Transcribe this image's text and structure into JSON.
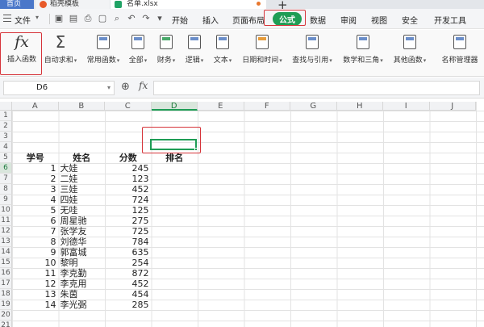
{
  "title_bar": {
    "tabs": [
      {
        "label": "首页",
        "active": false
      },
      {
        "label": "稻壳模板",
        "active": false
      },
      {
        "label": "名单.xlsx",
        "active": true
      }
    ],
    "new_tab_label": "+"
  },
  "menu_bar": {
    "file_label": "文件",
    "quick_access_icons": [
      "save-icon",
      "export-pdf-icon",
      "print-icon",
      "print-preview-icon",
      "search-doc-icon",
      "undo-icon",
      "redo-icon",
      "more-icon"
    ],
    "tabs": [
      {
        "label": "开始",
        "active": false
      },
      {
        "label": "插入",
        "active": false
      },
      {
        "label": "页面布局",
        "active": false
      },
      {
        "label": "公式",
        "active": true
      },
      {
        "label": "数据",
        "active": false
      },
      {
        "label": "审阅",
        "active": false
      },
      {
        "label": "视图",
        "active": false
      },
      {
        "label": "安全",
        "active": false
      },
      {
        "label": "开发工具",
        "active": false
      }
    ]
  },
  "ribbon": {
    "insert_function": {
      "icon": "fx",
      "label": "插入函数"
    },
    "buttons": [
      {
        "label": "自动求和",
        "icon": "sigma-icon",
        "dropdown": true
      },
      {
        "label": "常用函数",
        "icon": "star-function-icon",
        "dropdown": true
      },
      {
        "label": "全部",
        "icon": "all-functions-icon",
        "dropdown": true
      },
      {
        "label": "财务",
        "icon": "finance-icon",
        "dropdown": true
      },
      {
        "label": "逻辑",
        "icon": "logic-icon",
        "dropdown": true
      },
      {
        "label": "文本",
        "icon": "text-function-icon",
        "dropdown": true
      },
      {
        "label": "日期和时间",
        "icon": "clock-icon",
        "dropdown": true
      },
      {
        "label": "查找与引用",
        "icon": "lookup-icon",
        "dropdown": true
      },
      {
        "label": "数学和三角",
        "icon": "math-icon",
        "dropdown": true
      },
      {
        "label": "其他函数",
        "icon": "other-functions-icon",
        "dropdown": true
      },
      {
        "label": "名称管理器",
        "icon": "name-manager-icon",
        "dropdown": false
      }
    ]
  },
  "formula_bar": {
    "name_box": "D6",
    "fx_label": "fx",
    "formula": ""
  },
  "sheet": {
    "columns": [
      "A",
      "B",
      "C",
      "D",
      "E",
      "F",
      "G",
      "H",
      "I",
      "J"
    ],
    "selected_column": "D",
    "rows": [
      "1",
      "2",
      "3",
      "4",
      "5",
      "6",
      "7",
      "8",
      "9",
      "10",
      "11",
      "12",
      "13",
      "14",
      "15",
      "16",
      "17",
      "18",
      "19",
      "20",
      "21"
    ],
    "selected_row": "6",
    "header_row": {
      "A": "学号",
      "B": "姓名",
      "C": "分数",
      "D": "排名"
    },
    "records": [
      {
        "id": "1",
        "name": "大娃",
        "score": "245"
      },
      {
        "id": "2",
        "name": "二娃",
        "score": "123"
      },
      {
        "id": "3",
        "name": "三娃",
        "score": "452"
      },
      {
        "id": "4",
        "name": "四娃",
        "score": "724"
      },
      {
        "id": "5",
        "name": "无哇",
        "score": "125"
      },
      {
        "id": "6",
        "name": "周星驰",
        "score": "275"
      },
      {
        "id": "7",
        "name": "张学友",
        "score": "725"
      },
      {
        "id": "8",
        "name": "刘德华",
        "score": "784"
      },
      {
        "id": "9",
        "name": "郭富城",
        "score": "635"
      },
      {
        "id": "10",
        "name": "黎明",
        "score": "254"
      },
      {
        "id": "11",
        "name": "李克勤",
        "score": "872"
      },
      {
        "id": "12",
        "name": "李克用",
        "score": "452"
      },
      {
        "id": "13",
        "name": "朱茵",
        "score": "454"
      },
      {
        "id": "14",
        "name": "李光弼",
        "score": "285"
      }
    ],
    "active_cell": "D6"
  },
  "colors": {
    "accent_green": "#1e9d55",
    "highlight_red": "#d6343a",
    "home_tab_blue": "#4a77c9"
  }
}
